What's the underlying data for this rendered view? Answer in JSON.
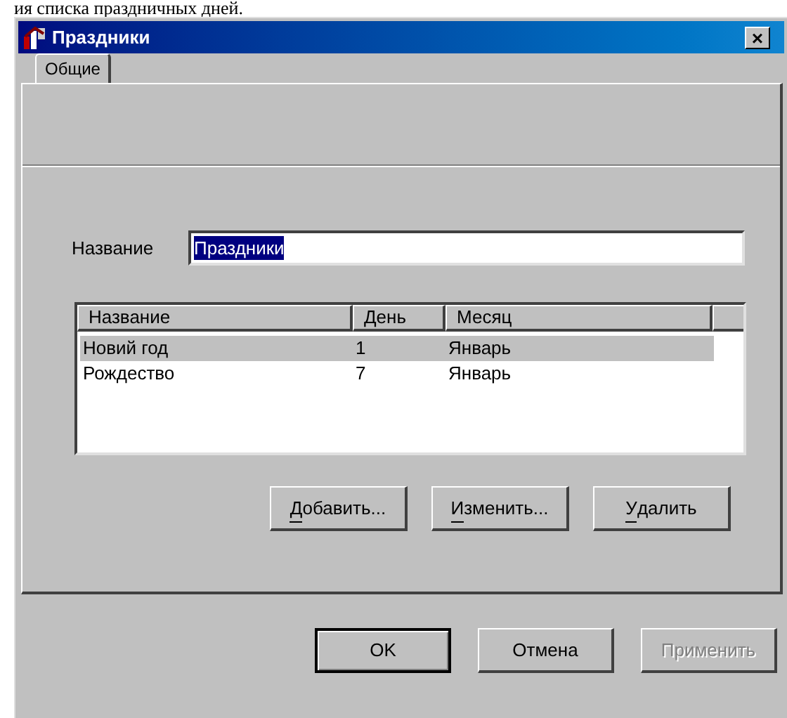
{
  "document_text": "ия списка праздничных дней.",
  "window": {
    "title": "Праздники",
    "close": "×"
  },
  "tabs": [
    {
      "label": "Общие",
      "selected": true
    }
  ],
  "name_field": {
    "label": "Название",
    "value": "Праздники",
    "selected_text": true
  },
  "table": {
    "columns": [
      "Название",
      "День",
      "Месяц"
    ],
    "rows": [
      {
        "cells": [
          "Новий год",
          "1",
          "Январь"
        ],
        "selected": true
      },
      {
        "cells": [
          "Рождество",
          "7",
          "Январь"
        ],
        "selected": false
      }
    ]
  },
  "list_buttons": [
    {
      "label": "Добавить...",
      "underline_first": true
    },
    {
      "label": "Изменить...",
      "underline_first": true
    },
    {
      "label": "Удалить",
      "underline_first": true
    }
  ],
  "dialog_buttons": [
    {
      "label": "OK",
      "default": true,
      "disabled": false
    },
    {
      "label": "Отмена",
      "default": false,
      "disabled": false
    },
    {
      "label": "Применить",
      "default": false,
      "disabled": true
    }
  ]
}
